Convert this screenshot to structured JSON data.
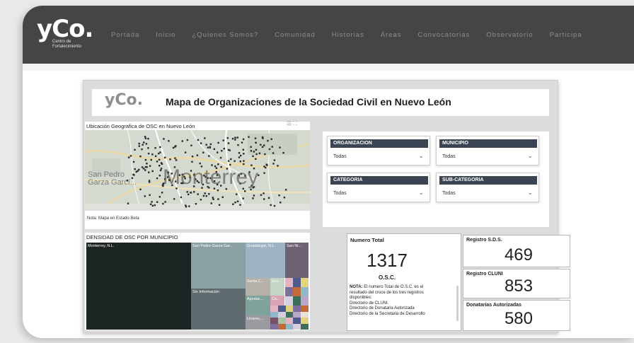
{
  "site": {
    "logo_text": "yCo.",
    "logo_sub": "Centro de Fortalecimiento",
    "nav": [
      "Portada",
      "Inicio",
      "¿Quienes Somos?",
      "Comunidad",
      "Historias",
      "Áreas",
      "Convocatorias",
      "Observatorio",
      "Participa"
    ]
  },
  "report": {
    "logo_text": "yCo.",
    "title": "Mapa de Organizaciones de la Sociedad Civil en Nuevo León",
    "map": {
      "title": "Ubicación Geografica de OSC en Nuevo León",
      "labels": {
        "city_main": "Monterrey",
        "city_secondary": "San Pedro Garza Garcí..."
      },
      "note": "Nota: Mapa en Estado Beta",
      "icons": [
        "filter-icon",
        "expand-icon"
      ]
    },
    "filters": [
      {
        "label": "ORGANIZACION",
        "value": "Todas"
      },
      {
        "label": "MUNICIPIO",
        "value": "Todas"
      },
      {
        "label": "CATEGORIA",
        "value": "Todas"
      },
      {
        "label": "SUB-CATEGORIA",
        "value": "Todas"
      }
    ],
    "density": {
      "title": "DENSIDAD DE OSC POR MUNICIPIO",
      "tiles": [
        {
          "label": "Monterrey, N.L.",
          "color": "#1c2523"
        },
        {
          "label": "San Pedro Garza Gar..",
          "color": "#8ba0a3"
        },
        {
          "label": "Guadalupe, N.L.",
          "color": "#9fb3c4"
        },
        {
          "label": "San Ni...",
          "color": "#6d6375"
        },
        {
          "label": "Sin Información",
          "color": "#5f6b6e"
        },
        {
          "label": "Santa C...",
          "color": "#b6b1a8"
        },
        {
          "label": "Gra...",
          "color": "#c3d5c7"
        },
        {
          "label": "Apodac...",
          "color": "#7fa29a"
        },
        {
          "label": "Ca...",
          "color": "#d8a4b4"
        },
        {
          "label": "Linares,...",
          "color": "#9a9aa0"
        }
      ]
    },
    "numero_total": {
      "label": "Numero Total",
      "value": "1317",
      "sub": "O.S.C.",
      "nota_lead": "NOTA:",
      "nota_lines": [
        "El numero Total de O.S.C. es el",
        "resultado del cruce de los tres registros",
        "disponibles:",
        "Directorio de CLUNI.",
        "Directorio de Donataria Autorizada",
        "Directorio de la Secretaria de Desarrollo"
      ]
    },
    "registros": [
      {
        "label": "Registro S.D.S.",
        "value": "469"
      },
      {
        "label": "Registro CLUNI",
        "value": "853"
      },
      {
        "label": "Donatarias Autorizadas",
        "value": "580"
      }
    ]
  }
}
